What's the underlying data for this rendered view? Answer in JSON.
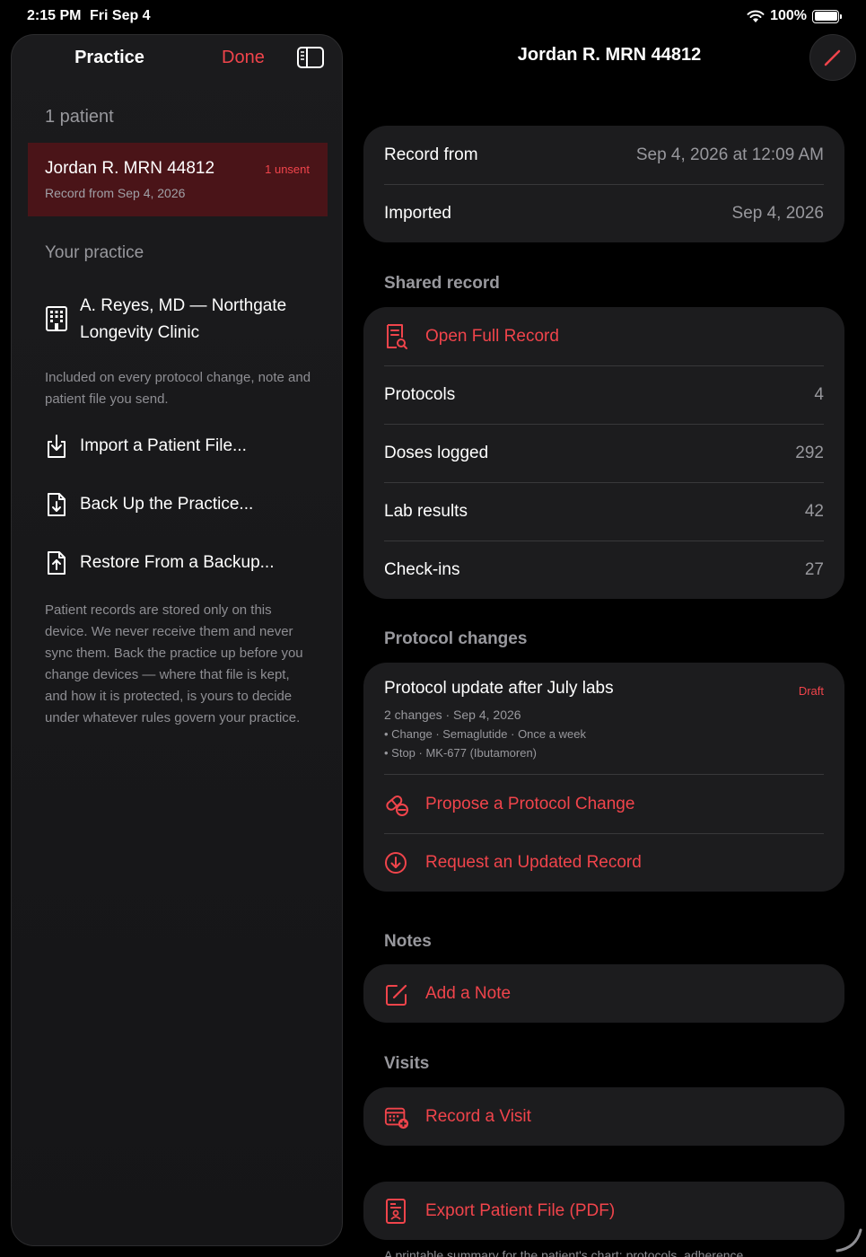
{
  "status_bar": {
    "time": "2:15 PM",
    "date": "Fri Sep 4",
    "battery": "100%"
  },
  "sidebar": {
    "title": "Practice",
    "done_label": "Done",
    "patient_count": "1 patient",
    "patient": {
      "name": "Jordan R.  MRN 44812",
      "subtitle": "Record from Sep 4, 2026",
      "badge": "1 unsent"
    },
    "section_title": "Your practice",
    "practice_name": "A. Reyes, MD — Northgate Longevity Clinic",
    "practice_caption": "Included on every protocol change, note and patient file you send.",
    "actions": [
      {
        "label": "Import a Patient File...",
        "icon": "tray-arrow-down-icon"
      },
      {
        "label": "Back Up the Practice...",
        "icon": "doc-arrow-down-icon"
      },
      {
        "label": "Restore From a Backup...",
        "icon": "doc-arrow-up-icon"
      }
    ],
    "footer_caption": "Patient records are stored only on this device. We never receive them and never sync them. Back the practice up before you change devices — where that file is kept, and how it is protected, is yours to decide under whatever rules govern your practice."
  },
  "main": {
    "title": "Jordan R.  MRN 44812",
    "record_info": {
      "rows": [
        {
          "label": "Record from",
          "value": "Sep 4, 2026 at 12:09 AM"
        },
        {
          "label": "Imported",
          "value": "Sep 4, 2026"
        }
      ]
    },
    "shared_record": {
      "header": "Shared record",
      "open_label": "Open Full Record",
      "rows": [
        {
          "label": "Protocols",
          "value": "4"
        },
        {
          "label": "Doses logged",
          "value": "292"
        },
        {
          "label": "Lab results",
          "value": "42"
        },
        {
          "label": "Check-ins",
          "value": "27"
        }
      ]
    },
    "protocol_changes": {
      "header": "Protocol changes",
      "draft": {
        "title": "Protocol update after July labs",
        "status": "Draft",
        "meta": "2 changes · Sep 4, 2026",
        "lines": [
          "• Change · Semaglutide · Once a week",
          "• Stop · MK-677 (Ibutamoren)"
        ]
      },
      "propose_label": "Propose a Protocol Change",
      "request_label": "Request an Updated Record"
    },
    "notes": {
      "header": "Notes",
      "add_label": "Add a Note"
    },
    "visits": {
      "header": "Visits",
      "record_label": "Record a Visit"
    },
    "export": {
      "label": "Export Patient File (PDF)",
      "caption": "A printable summary for the patient's chart: protocols, adherence..."
    }
  },
  "colors": {
    "accent": "#f0444b",
    "background": "#000000",
    "card": "#1c1c1e",
    "selected_row": "#4a1418"
  }
}
